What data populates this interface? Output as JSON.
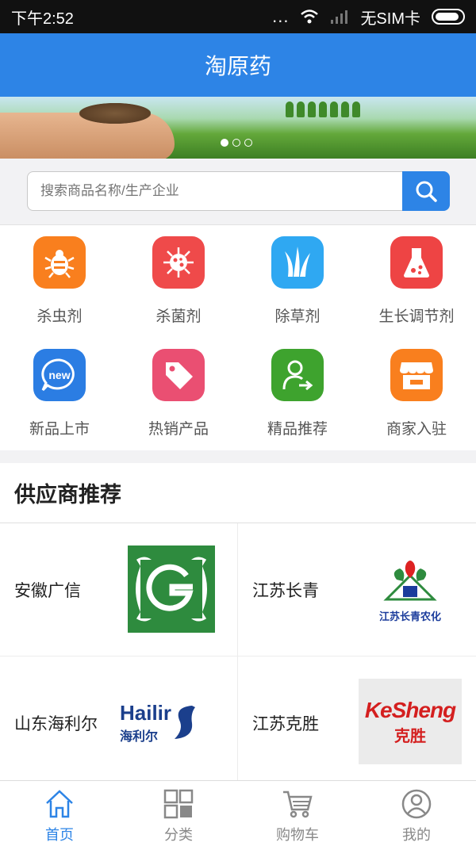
{
  "status": {
    "time": "下午2:52",
    "dots": "...",
    "carrier": "无SIM卡"
  },
  "header": {
    "title": "淘原药"
  },
  "search": {
    "placeholder": "搜索商品名称/生产企业"
  },
  "categories": [
    {
      "label": "杀虫剂",
      "color": "#f97f1e",
      "icon": "bug-icon"
    },
    {
      "label": "杀菌剂",
      "color": "#ef4a4a",
      "icon": "germ-icon"
    },
    {
      "label": "除草剂",
      "color": "#2fa8f2",
      "icon": "grass-icon"
    },
    {
      "label": "生长调节剂",
      "color": "#ee4444",
      "icon": "flask-icon"
    },
    {
      "label": "新品上市",
      "color": "#2b7de3",
      "icon": "new-badge-icon"
    },
    {
      "label": "热销产品",
      "color": "#ea4f72",
      "icon": "tag-icon"
    },
    {
      "label": "精品推荐",
      "color": "#3ea32e",
      "icon": "user-arrow-icon"
    },
    {
      "label": "商家入驻",
      "color": "#f97f1e",
      "icon": "store-icon"
    }
  ],
  "suppliers": {
    "title": "供应商推荐",
    "items": [
      {
        "name": "安徽广信"
      },
      {
        "name": "江苏长青",
        "logo_text": "江苏长青农化"
      },
      {
        "name": "山东海利尔",
        "logo_text": "Hailir",
        "logo_sub": "海利尔"
      },
      {
        "name": "江苏克胜",
        "logo_text": "KeSheng",
        "logo_sub": "克胜"
      }
    ]
  },
  "tabs": [
    {
      "label": "首页",
      "icon": "home-icon",
      "active": true
    },
    {
      "label": "分类",
      "icon": "grid-icon",
      "active": false
    },
    {
      "label": "购物车",
      "icon": "cart-icon",
      "active": false
    },
    {
      "label": "我的",
      "icon": "user-icon",
      "active": false
    }
  ],
  "colors": {
    "accent": "#2d84e6"
  }
}
